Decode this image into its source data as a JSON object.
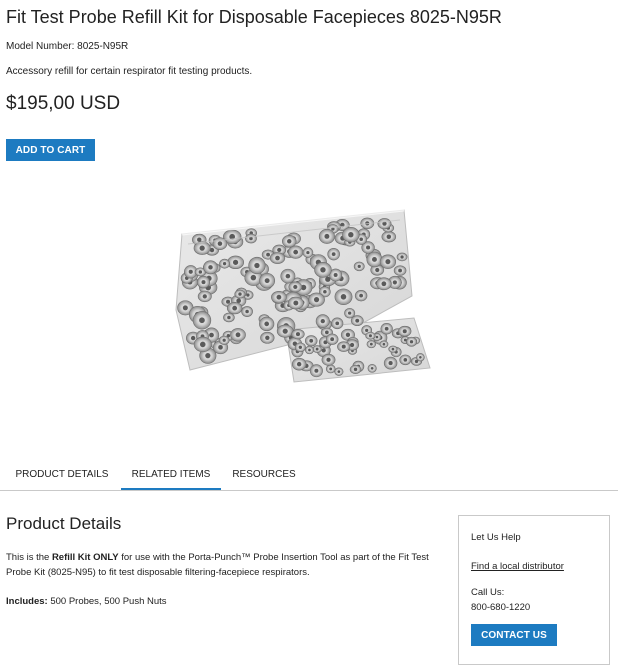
{
  "product": {
    "title": "Fit Test Probe Refill Kit for Disposable Facepieces 8025-N95R",
    "model_number": "Model Number: 8025-N95R",
    "description": "Accessory refill for certain respirator fit testing products.",
    "price": "$195,00 USD",
    "add_to_cart_label": "ADD TO CART",
    "image_alt": "Bags of fit test probes and push nuts"
  },
  "tabs": [
    {
      "label": "PRODUCT DETAILS",
      "active": false
    },
    {
      "label": "RELATED ITEMS",
      "active": true
    },
    {
      "label": "RESOURCES",
      "active": false
    }
  ],
  "details": {
    "heading": "Product Details",
    "para_prefix": "This is the ",
    "para_bold": "Refill Kit ONLY",
    "para_suffix": " for use with the Porta-Punch™ Probe Insertion Tool as part of the Fit Test Probe Kit (8025-N95) to fit test disposable filtering-facepiece respirators.",
    "includes_label": "Includes:",
    "includes_value": " 500 Probes, 500 Push Nuts"
  },
  "help": {
    "title": "Let Us Help",
    "distributor_link": "Find a local distributor",
    "call_label": "Call Us:",
    "phone": "800-680-1220",
    "contact_label": "CONTACT US"
  },
  "colors": {
    "accent": "#1d7bc1",
    "border": "#c9c9c9"
  }
}
